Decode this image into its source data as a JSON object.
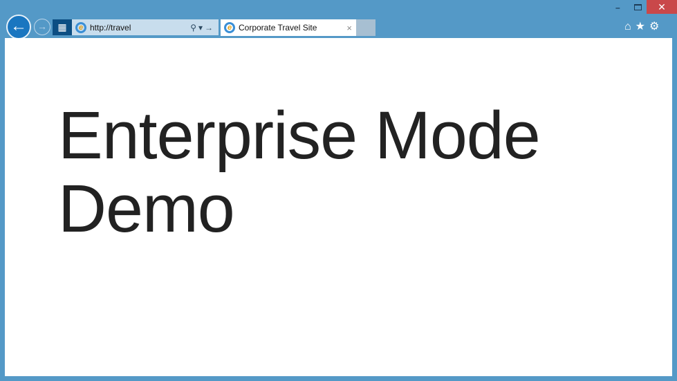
{
  "browser": {
    "address": "http://travel",
    "tab_title": "Corporate Travel Site",
    "close_tab": "×",
    "window": {
      "minimize": "–",
      "close": "✕"
    },
    "toolbar_icons": [
      "home-icon",
      "star-icon",
      "gear-icon"
    ]
  },
  "page": {
    "heading_line1": "Enterprise Mode",
    "heading_line2": "Demo"
  },
  "colors": {
    "frame": "#5499c7",
    "close": "#c9484a",
    "address_bg": "#c8dded"
  }
}
